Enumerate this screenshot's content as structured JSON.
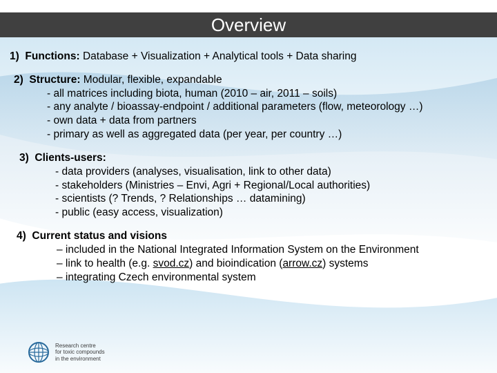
{
  "title": "Overview",
  "section1": {
    "num": "1)",
    "head": "Functions:",
    "rest": " Database + Visualization + Analytical tools + Data sharing"
  },
  "section2": {
    "num": "2)",
    "head": "Structure:",
    "rest": " Modular, flexible, expandable",
    "b1": "- all matrices including biota, human (2010 – air, 2011 – soils)",
    "b2": "- any analyte / bioassay-endpoint  / additional parameters (flow, meteorology …)",
    "b3": "- own data + data from partners",
    "b4": "- primary as well as aggregated data (per year, per country …)"
  },
  "section3": {
    "num": "3)",
    "head": "Clients-users:",
    "b1": "- data providers (analyses, visualisation, link to other data)",
    "b2": "- stakeholders (Ministries – Envi, Agri + Regional/Local authorities)",
    "b3": "- scientists (? Trends, ? Relationships … datamining)",
    "b4": "- public (easy access, visualization)"
  },
  "section4": {
    "num": "4)",
    "head": "Current status and visions",
    "b1a": "– included in the National Integrated Information System on the Environment",
    "b2a": "– link to health (e.g. ",
    "b2link": "svod.cz",
    "b2b": ") and bioindication (",
    "b2link2": "arrow.cz",
    "b2c": ") systems",
    "b3": "– integrating Czech environmental system"
  },
  "footer": {
    "l1": "Research centre",
    "l2": "for toxic compounds",
    "l3": "in the environment"
  }
}
